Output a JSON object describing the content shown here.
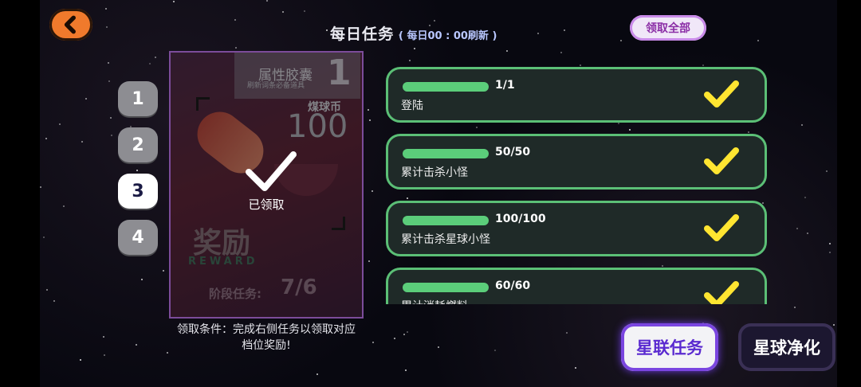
{
  "header": {
    "title": "每日任务",
    "refresh_note": "( 每日00 : 00刷新 )",
    "claim_all_label": "领取全部"
  },
  "tiers": [
    {
      "label": "1",
      "active": false
    },
    {
      "label": "2",
      "active": false
    },
    {
      "label": "3",
      "active": true
    },
    {
      "label": "4",
      "active": false
    }
  ],
  "reward_card": {
    "name": "属性胶囊",
    "description": "刷新词条必备道具",
    "tier_number": "1",
    "currency_label": "煤球币",
    "currency_amount": "100",
    "claimed_text": "已领取",
    "reward_cn": "奖励",
    "reward_en": "REWARD",
    "stage_label": "阶段任务:",
    "stage_value": "7/6"
  },
  "condition_text": "领取条件：完成右侧任务以领取对应档位奖励!",
  "tasks": [
    {
      "progress_text": "1/1",
      "name": "登陆",
      "progress": 1.0,
      "done": true
    },
    {
      "progress_text": "50/50",
      "name": "累计击杀小怪",
      "progress": 1.0,
      "done": true
    },
    {
      "progress_text": "100/100",
      "name": "累计击杀星球小怪",
      "progress": 1.0,
      "done": true
    },
    {
      "progress_text": "60/60",
      "name": "累计消耗燃料",
      "progress": 1.0,
      "done": true
    }
  ],
  "bottom_buttons": {
    "lianren_label": "星联任务",
    "jinghua_label": "星球净化"
  },
  "colors": {
    "accent_orange": "#f07a2c",
    "progress_green": "#5bcd7a",
    "check_yellow": "#ffe531",
    "purple": "#7a45e0"
  }
}
